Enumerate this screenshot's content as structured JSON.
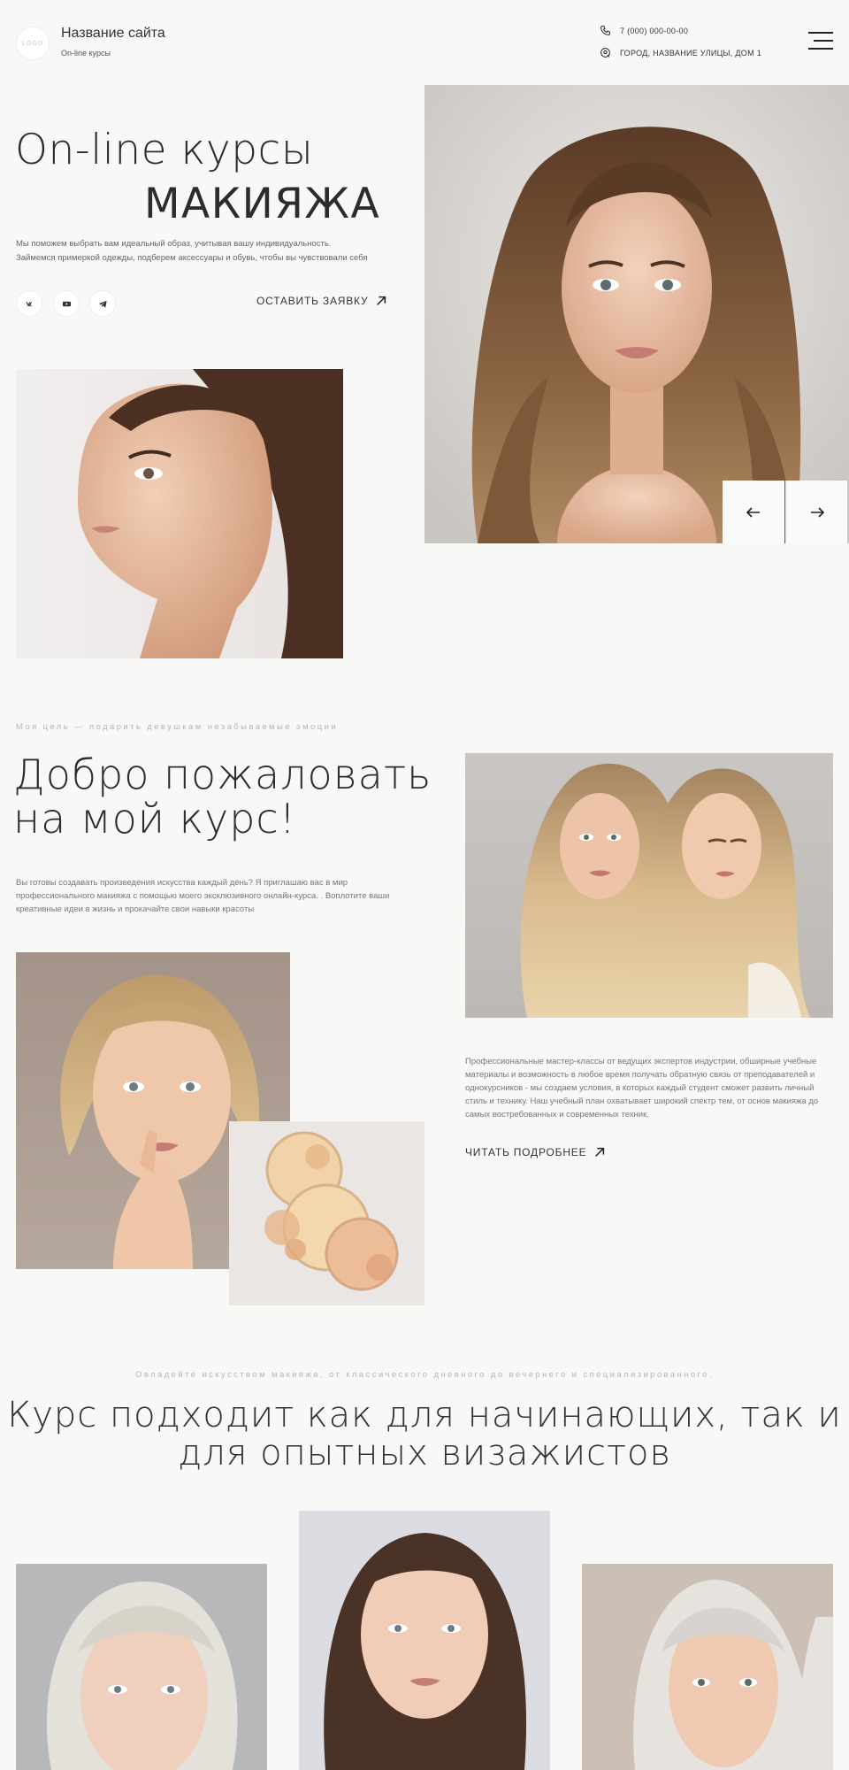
{
  "header": {
    "logo_text": "LOGO",
    "site_name": "Название сайта",
    "site_sub": "On-line курсы",
    "phone": "7 (000) 000-00-00",
    "address": "ГОРОД, НАЗВАНИЕ УЛИЦЫ, ДОМ 1",
    "menu_icon": "hamburger-icon"
  },
  "hero": {
    "title_line1": "On-line курсы",
    "title_line2": "МАКИЯЖА",
    "description_line1": "Мы поможем выбрать вам идеальный образ, учитывая вашу индивидуальность.",
    "description_line2": "Займемся примеркой одежды, подберем аксессуары и обувь, чтобы вы чувствовали себя",
    "social_icons": [
      "vk-icon",
      "youtube-icon",
      "telegram-icon"
    ],
    "cta_label": "ОСТАВИТЬ ЗАЯВКУ",
    "prev_icon": "arrow-left-icon",
    "next_icon": "arrow-right-icon"
  },
  "about": {
    "eyebrow": "Моя цель — подарить девушкам незабываемые эмоции",
    "title_line1": "Добро пожаловать",
    "title_line2": "на мой курс!",
    "description": "Вы готовы создавать произведения искусства каждый день? Я приглашаю вас в мир профессионального макияжа с помощью моего эксклюзивного онлайн-курса. . Воплотите ваши креативные идеи в жизнь и прокачайте свои навыки красоты",
    "long_description": "Профессиональные мастер-классы от ведущих экспертов индустрии, обширные учебные материалы и возможность в любое время получать обратную связь от преподавателей и однокурсников - мы создаем условия, в которых каждый студент сможет развить личный стиль и технику. Наш учебный план охватывает широкий спектр тем, от основ макияжа до самых востребованных и современных техник.",
    "read_more_label": "ЧИТАТЬ ПОДРОБНЕЕ"
  },
  "course": {
    "eyebrow": "Овладейте искусством макияжа, от классического дневного до вечернего и специализированного.",
    "title_line1": "Курс подходит как для начинающих, так и",
    "title_line2": "для опытных визажистов"
  },
  "colors": {
    "background": "#f8f8f7",
    "text_dark": "#2c2c2c",
    "text_muted": "#777777",
    "eyebrow": "#b5b5b5"
  }
}
